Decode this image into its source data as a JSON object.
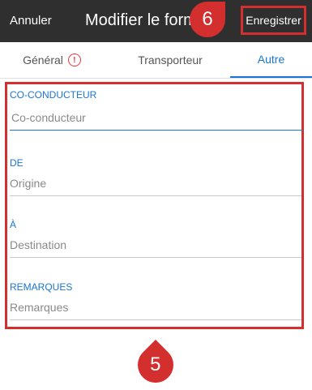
{
  "header": {
    "cancel_label": "Annuler",
    "title": "Modifier le form",
    "save_label": "Enregistrer"
  },
  "markers": {
    "top": "6",
    "bottom": "5"
  },
  "tabs": [
    {
      "label": "Général"
    },
    {
      "label": "Transporteur"
    },
    {
      "label": "Autre"
    }
  ],
  "form": {
    "co_driver": {
      "label": "CO-CONDUCTEUR",
      "placeholder": "Co-conducteur",
      "value": ""
    },
    "from": {
      "label": "DE",
      "placeholder": "Origine",
      "value": ""
    },
    "to": {
      "label": "À",
      "placeholder": "Destination",
      "value": ""
    },
    "remarks": {
      "label": "REMARQUES",
      "placeholder": "Remarques",
      "value": ""
    }
  },
  "colors": {
    "accent": "#1976d2",
    "annotation": "#d32f2f",
    "header_bg": "#2f2f2f"
  }
}
